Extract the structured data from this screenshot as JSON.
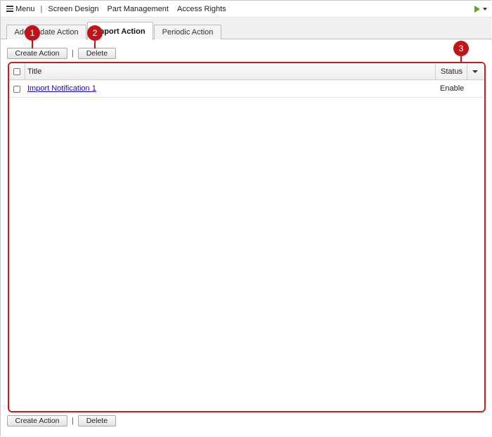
{
  "topbar": {
    "menu_label": "Menu",
    "items": [
      "Screen Design",
      "Part Management",
      "Access Rights"
    ],
    "run_icon": "play-icon",
    "dropdown_icon": "caret-down-icon",
    "accent_color": "#5aab1e"
  },
  "tabs": [
    {
      "label": "Add/Update Action",
      "active": false
    },
    {
      "label": "Import Action",
      "active": true
    },
    {
      "label": "Periodic Action",
      "active": false
    }
  ],
  "toolbar": {
    "create_label": "Create Action",
    "separator": "|",
    "delete_label": "Delete"
  },
  "grid": {
    "columns": [
      "Title",
      "Status"
    ],
    "rows": [
      {
        "title": "Import Notification 1",
        "status": "Enable"
      }
    ],
    "border_color": "#c81e1e"
  },
  "callouts": [
    "1",
    "2",
    "3"
  ],
  "callout_color": "#c0141b"
}
